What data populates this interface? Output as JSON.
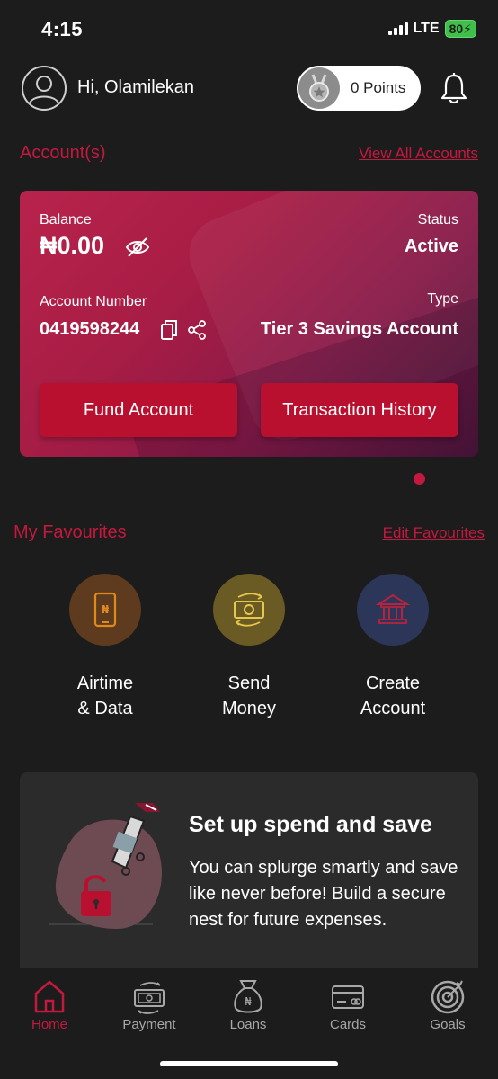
{
  "status_bar": {
    "time": "4:15",
    "network": "LTE",
    "battery": "80"
  },
  "header": {
    "greeting": "Hi, Olamilekan",
    "points": "0 Points"
  },
  "accounts": {
    "title": "Account(s)",
    "view_all": "View All Accounts",
    "card": {
      "balance_label": "Balance",
      "balance_value": "₦0.00",
      "status_label": "Status",
      "status_value": "Active",
      "account_number_label": "Account Number",
      "account_number_value": "0419598244",
      "type_label": "Type",
      "type_value": "Tier 3 Savings Account",
      "fund_button": "Fund Account",
      "history_button": "Transaction History"
    }
  },
  "favourites": {
    "title": "My Favourites",
    "edit": "Edit Favourites",
    "items": [
      {
        "label": "Airtime\n& Data",
        "icon": "phone-naira-icon",
        "color": "#5e3b1f"
      },
      {
        "label": "Send\nMoney",
        "icon": "money-transfer-icon",
        "color": "#6a5a23"
      },
      {
        "label": "Create\nAccount",
        "icon": "bank-icon",
        "color": "#2b3658"
      }
    ]
  },
  "promo": {
    "title": "Set up spend and save",
    "text": "You can splurge smartly and save like never before! Build a secure nest for future expenses."
  },
  "bottom_nav": {
    "items": [
      {
        "label": "Home",
        "icon": "home-icon",
        "active": true
      },
      {
        "label": "Payment",
        "icon": "payment-icon",
        "active": false
      },
      {
        "label": "Loans",
        "icon": "loans-icon",
        "active": false
      },
      {
        "label": "Cards",
        "icon": "cards-icon",
        "active": false
      },
      {
        "label": "Goals",
        "icon": "goals-icon",
        "active": false
      }
    ]
  },
  "colors": {
    "accent": "#c4193f",
    "background": "#1c1c1c",
    "button": "#b8102e"
  }
}
